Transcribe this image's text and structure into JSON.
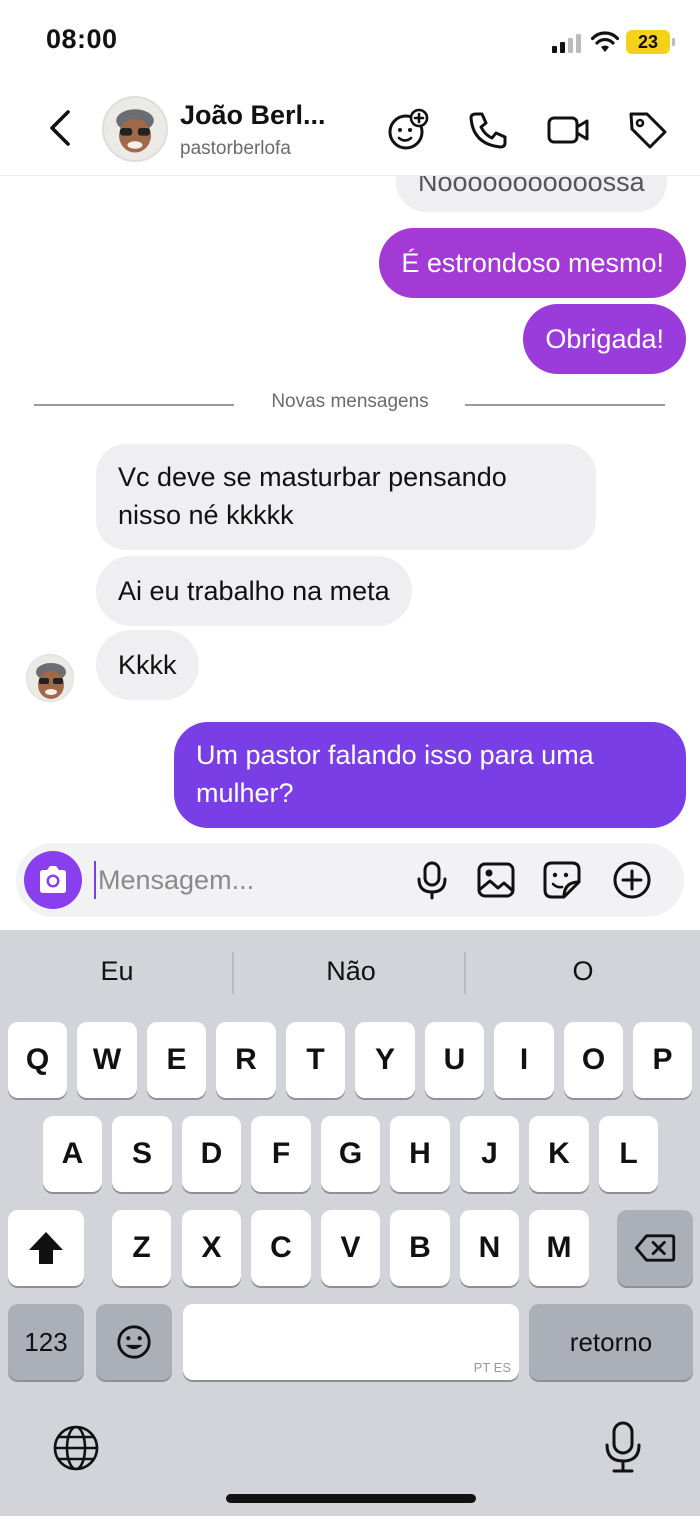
{
  "status": {
    "time": "08:00",
    "battery": "23"
  },
  "header": {
    "name": "João Berl...",
    "handle": "pastorberlofa"
  },
  "messages": {
    "cut_top": "Nooooooooooossa",
    "out_1": "É estrondoso mesmo!",
    "out_2": "Obrigada!",
    "divider": "Novas mensagens",
    "in_1_line1": "Vc deve se masturbar pensando",
    "in_1_line2": "nisso né kkkkk",
    "in_2": "Ai eu trabalho na meta",
    "in_3": "Kkkk",
    "out_3_line1": "Um pastor falando isso para uma",
    "out_3_line2": "mulher?"
  },
  "composer": {
    "placeholder": "Mensagem..."
  },
  "keyboard": {
    "suggestions": [
      "Eu",
      "Não",
      "O"
    ],
    "row1": [
      "Q",
      "W",
      "E",
      "R",
      "T",
      "Y",
      "U",
      "I",
      "O",
      "P"
    ],
    "row2": [
      "A",
      "S",
      "D",
      "F",
      "G",
      "H",
      "J",
      "K",
      "L"
    ],
    "row3": [
      "Z",
      "X",
      "C",
      "V",
      "B",
      "N",
      "M"
    ],
    "numbers_key": "123",
    "return_key": "retorno",
    "space_hint": "PT ES"
  },
  "colors": {
    "bubble_out_top": "#a43ad6",
    "bubble_out_bottom": "#7a3ee6",
    "bubble_in": "#efeff2",
    "camera_button": "#8a3fee",
    "keyboard_bg": "#d2d4da",
    "battery": "#f5d21a"
  },
  "icons": {
    "header": [
      "back-chevron-icon",
      "add-effects-icon",
      "phone-icon",
      "video-icon",
      "tag-icon"
    ],
    "composer": [
      "camera-icon",
      "microphone-icon",
      "image-icon",
      "sticker-icon",
      "plus-circle-icon"
    ],
    "keyboard": [
      "shift-icon",
      "backspace-icon",
      "emoji-icon",
      "globe-icon",
      "dictation-mic-icon"
    ]
  }
}
